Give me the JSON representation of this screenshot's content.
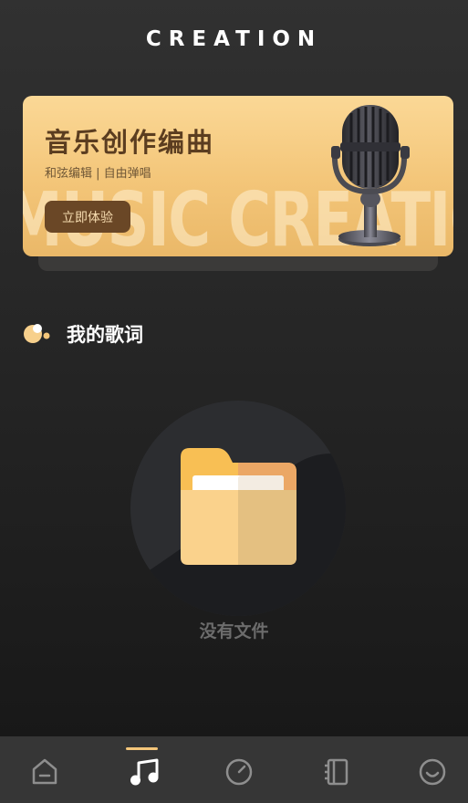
{
  "header": {
    "title": "CREATION"
  },
  "banner": {
    "title": "音乐创作编曲",
    "subtitle": "和弦编辑 | 自由弹唱",
    "button_label": "立即体验",
    "background_text": "MUSIC CREATION"
  },
  "lyrics_section": {
    "title": "我的歌词"
  },
  "empty_state": {
    "message": "没有文件"
  },
  "tab_bar": {
    "active_tab": "music",
    "tabs": [
      {
        "id": "home",
        "icon": "home-icon"
      },
      {
        "id": "music",
        "icon": "music-note-icon"
      },
      {
        "id": "metronome",
        "icon": "gauge-icon"
      },
      {
        "id": "notebook",
        "icon": "notebook-icon"
      },
      {
        "id": "profile",
        "icon": "smiley-icon"
      }
    ]
  },
  "colors": {
    "accent": "#f4c67a",
    "banner_dark": "#6a4726",
    "icon_inactive": "#8e8e8e",
    "background": "#252525"
  }
}
